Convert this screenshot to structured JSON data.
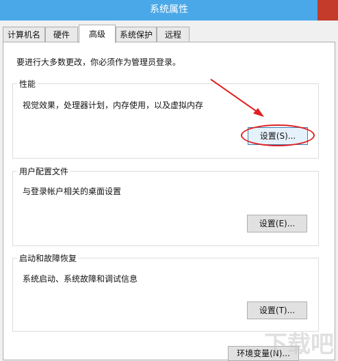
{
  "window": {
    "title": "系统属性"
  },
  "tabs": [
    {
      "label": "计算机名"
    },
    {
      "label": "硬件"
    },
    {
      "label": "高级",
      "active": true
    },
    {
      "label": "系统保护"
    },
    {
      "label": "远程"
    }
  ],
  "notice": "要进行大多数更改，你必须作为管理员登录。",
  "performance": {
    "label": "性能",
    "desc": "视觉效果，处理器计划，内存使用，以及虚拟内存",
    "button": "设置(S)..."
  },
  "user_profiles": {
    "label": "用户配置文件",
    "desc": "与登录帐户相关的桌面设置",
    "button": "设置(E)..."
  },
  "startup_recovery": {
    "label": "启动和故障恢复",
    "desc": "系统启动、系统故障和调试信息",
    "button": "设置(T)..."
  },
  "env_button": "环境变量(N)...",
  "colors": {
    "titlebar": "#4aa8e8",
    "annotation": "#e02020"
  },
  "watermark": "下载吧"
}
